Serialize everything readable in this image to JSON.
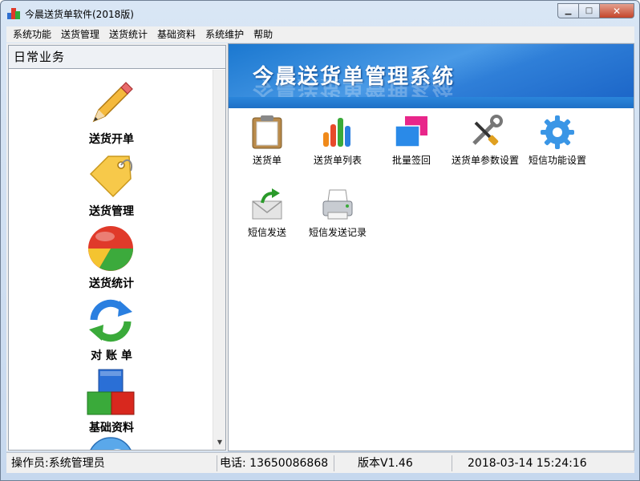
{
  "window": {
    "title": "今晨送货单软件(2018版)",
    "buttons": {
      "minimize": "▁",
      "maximize": "□",
      "close": "✕"
    }
  },
  "menu": [
    "系统功能",
    "送货管理",
    "送货统计",
    "基础资料",
    "系统维护",
    "帮助"
  ],
  "left_panel": {
    "header": "日常业务",
    "items": [
      {
        "label": "送货开单",
        "icon": "pencil-icon"
      },
      {
        "label": "送货管理",
        "icon": "tag-icon"
      },
      {
        "label": "送货统计",
        "icon": "pie-chart-icon"
      },
      {
        "label": "对 账 单",
        "icon": "refresh-icon"
      },
      {
        "label": "基础资料",
        "icon": "blocks-icon"
      },
      {
        "label": "",
        "icon": "globe-icon"
      }
    ],
    "scroll_arrow": "▼"
  },
  "banner": {
    "title": "今晨送货单管理系统"
  },
  "functions": [
    {
      "label": "送货单",
      "icon": "clipboard-icon"
    },
    {
      "label": "送货单列表",
      "icon": "bar-chart-icon"
    },
    {
      "label": "批量签回",
      "icon": "windows-icon"
    },
    {
      "label": "送货单参数设置",
      "icon": "tools-icon"
    },
    {
      "label": "短信功能设置",
      "icon": "gear-icon"
    },
    {
      "label": "短信发送",
      "icon": "mail-send-icon"
    },
    {
      "label": "短信发送记录",
      "icon": "printer-icon"
    }
  ],
  "status": {
    "operator": "操作员:系统管理员",
    "phone": "电话: 13650086868",
    "version": "版本V1.46",
    "datetime": "2018-03-14  15:24:16"
  },
  "colors": {
    "banner_blue": "#1b78d0",
    "window_frame": "#c6d8ee",
    "close_red": "#c4452a"
  }
}
